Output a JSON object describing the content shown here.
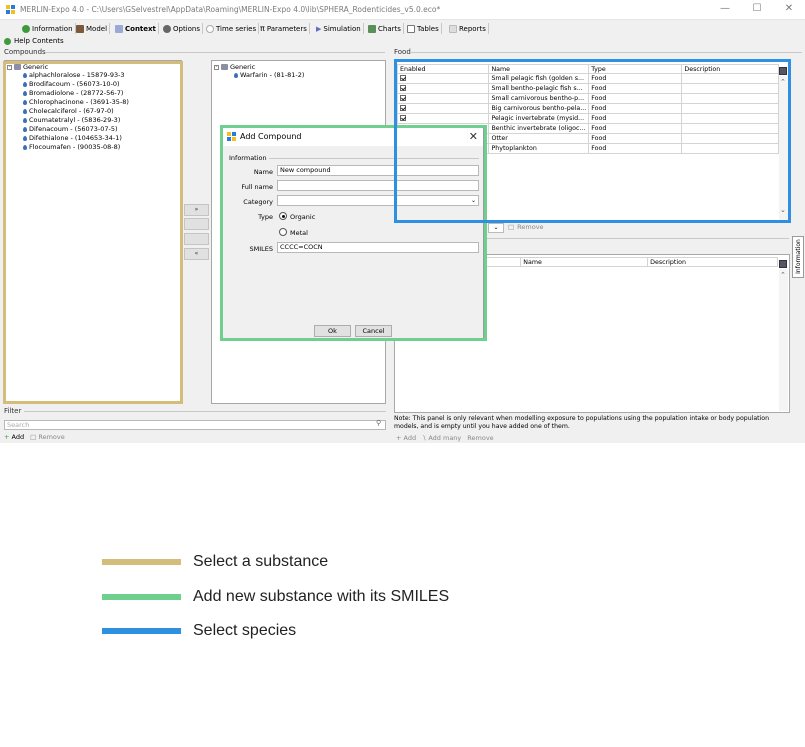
{
  "window": {
    "title": "MERLIN-Expo 4.0 - C:\\Users\\GSelvestrel\\AppData\\Roaming\\MERLIN-Expo 4.0\\lib\\SPHERA_Rodenticides_v5.0.eco*",
    "minimize_glyph": "—",
    "maximize_glyph": "☐",
    "close_glyph": "✕"
  },
  "toolbar": {
    "tabs": [
      {
        "label": "Information",
        "icon": "info-icon",
        "color": "#3d9b3d"
      },
      {
        "label": "Model",
        "icon": "model-icon",
        "color": "#7a5a3a"
      },
      {
        "label": "Context",
        "icon": "context-icon",
        "color": "#9aa9d6"
      },
      {
        "label": "Options",
        "icon": "options-icon",
        "color": "#666666"
      },
      {
        "label": "Time series",
        "icon": "clock-icon",
        "color": "#aaaaaa"
      },
      {
        "label": "Parameters",
        "icon": "pi-icon",
        "color": "#333333"
      },
      {
        "label": "Simulation",
        "icon": "play-icon",
        "color": "#5a6fbf"
      },
      {
        "label": "Charts",
        "icon": "chart-icon",
        "color": "#5a8f5a"
      },
      {
        "label": "Tables",
        "icon": "table-icon",
        "color": "#777777"
      },
      {
        "label": "Reports",
        "icon": "report-icon",
        "color": "#bbbbbb"
      }
    ],
    "help_label": "Help Contents"
  },
  "compounds": {
    "section_label": "Compounds",
    "root_label": "Generic",
    "items": [
      "alphachloralose - 15879-93-3",
      "Brodifacoum - (56073-10-0)",
      "Bromadiolone - (28772-56-7)",
      "Chlorophacinone - (3691-35-8)",
      "Cholecalciferol - (67-97-0)",
      "Coumatetralyl - (5836-29-3)",
      "Difenacoum - (56073-07-5)",
      "Difethialone - (104653-34-1)",
      "Flocoumafen - (90035-08-8)"
    ]
  },
  "selected": {
    "root_label": "Generic",
    "items": [
      "Warfarin - (81-81-2)"
    ]
  },
  "transfer_buttons": {
    "add_all": "»",
    "remove_all": "«"
  },
  "filter": {
    "label": "Filter",
    "placeholder": "Search",
    "add_label": "Add",
    "remove_label": "Remove"
  },
  "food": {
    "section_label": "Food",
    "columns": [
      "Enabled",
      "Name",
      "Type",
      "Description"
    ],
    "rows": [
      {
        "name": "Small pelagic fish (golden s...",
        "type": "Food"
      },
      {
        "name": "Small bentho-pelagic fish s...",
        "type": "Food"
      },
      {
        "name": "Small carnivorous bentho-p...",
        "type": "Food"
      },
      {
        "name": "Big carnivorous bentho-pela...",
        "type": "Food"
      },
      {
        "name": "Pelagic invertebrate (mysid...",
        "type": "Food"
      },
      {
        "name": "Benthic invertebrate (oligoc...",
        "type": "Food"
      },
      {
        "name": "Otter",
        "type": "Food"
      },
      {
        "name": "Phytoplankton",
        "type": "Food"
      }
    ],
    "remove_label": "Remove"
  },
  "populations": {
    "columns": [
      "Name",
      "Description"
    ],
    "note": "Note: This panel is only relevant when modelling exposure to populations using the population intake or body population models, and is empty until you have added one of them.",
    "add_label": "Add",
    "add_many_label": "Add many",
    "remove_label": "Remove",
    "side_tab_label": "Information"
  },
  "dialog": {
    "title": "Add Compound",
    "group_label": "Information",
    "name_label": "Name",
    "name_value": "New compound",
    "fullname_label": "Full name",
    "fullname_value": "",
    "category_label": "Category",
    "category_value": "",
    "type_label": "Type",
    "type_options": [
      "Organic",
      "Metal"
    ],
    "type_selected": "Organic",
    "smiles_label": "SMILES",
    "smiles_value": "CCCC=COCN",
    "ok_label": "Ok",
    "cancel_label": "Cancel"
  },
  "legend": [
    {
      "label": "Select a substance",
      "color": "#d4bd7a"
    },
    {
      "label": "Add new substance with its SMILES",
      "color": "#6fcf8f"
    },
    {
      "label": "Select species",
      "color": "#2f8fe0"
    }
  ]
}
